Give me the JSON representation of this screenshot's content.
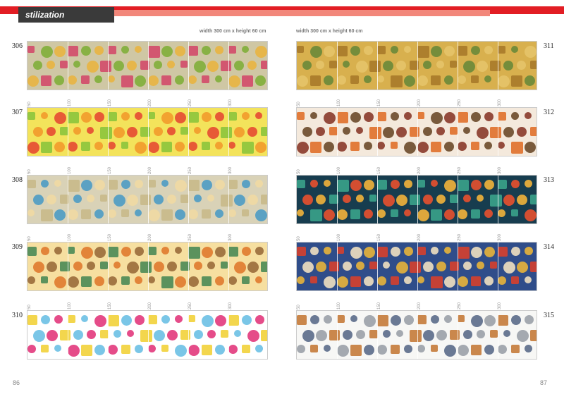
{
  "header": {
    "section": "stilization"
  },
  "dimensions": {
    "left": "width 300 cm x height 60 cm",
    "right": "width 300 cm x height 60 cm"
  },
  "ruler_marks": [
    "50",
    "100",
    "150",
    "200",
    "250",
    "300"
  ],
  "left_items": [
    {
      "num": "306",
      "bg": "#cfc7a4",
      "c1": "#d24a6a",
      "c2": "#7fae3a",
      "c3": "#e8b441"
    },
    {
      "num": "307",
      "bg": "#f3e35b",
      "c1": "#e64a32",
      "c2": "#8cc43c",
      "c3": "#f29a2b"
    },
    {
      "num": "308",
      "bg": "#d9d2b7",
      "c1": "#4d9bc4",
      "c2": "#efd9a3",
      "c3": "#c8b98a"
    },
    {
      "num": "309",
      "bg": "#f6dfa0",
      "c1": "#4b8a55",
      "c2": "#e07a2e",
      "c3": "#9a6b3a"
    },
    {
      "num": "310",
      "bg": "#ffffff",
      "c1": "#e2397c",
      "c2": "#f2d23a",
      "c3": "#6cc0e4"
    }
  ],
  "right_items": [
    {
      "num": "311",
      "bg": "#d8b04e",
      "c1": "#a87a2a",
      "c2": "#6a8a3a",
      "c3": "#e6c46a"
    },
    {
      "num": "312",
      "bg": "#f4e9dc",
      "c1": "#8a3a2a",
      "c2": "#e0702a",
      "c3": "#6b4a2a"
    },
    {
      "num": "313",
      "bg": "#173d4f",
      "c1": "#e8502e",
      "c2": "#f2b23a",
      "c3": "#3aa28a"
    },
    {
      "num": "314",
      "bg": "#2f4d8a",
      "c1": "#d6402c",
      "c2": "#f0e0c0",
      "c3": "#e8b43a"
    },
    {
      "num": "315",
      "bg": "#f7f7f5",
      "c1": "#9aa0a8",
      "c2": "#c47a3a",
      "c3": "#5a6a8a"
    }
  ],
  "page_numbers": {
    "left": "86",
    "right": "87"
  }
}
